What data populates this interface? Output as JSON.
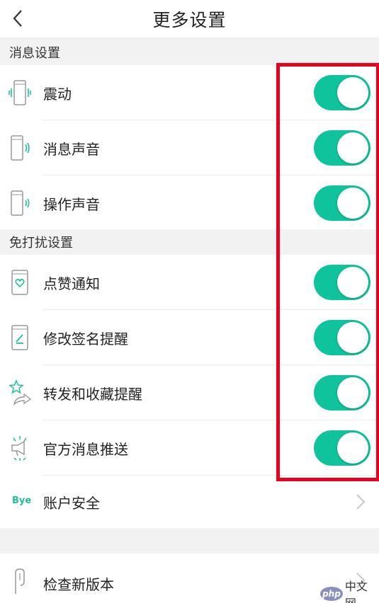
{
  "header": {
    "title": "更多设置"
  },
  "sections": {
    "message": "消息设置",
    "dnd": "免打扰设置"
  },
  "rows": {
    "vibrate": "震动",
    "message_sound": "消息声音",
    "action_sound": "操作声音",
    "like_notify": "点赞通知",
    "signature_remind": "修改签名提醒",
    "forward_fav_remind": "转发和收藏提醒",
    "official_push": "官方消息推送",
    "account_security": "账户安全",
    "check_update": "检查新版本"
  },
  "icons": {
    "bye_text": "Bye"
  },
  "toggles_on": [
    true,
    true,
    true,
    true,
    true,
    true,
    true
  ],
  "colors": {
    "accent": "#0fc49c",
    "highlight_border": "#e8001c",
    "icon_teal": "#1fbf9a"
  },
  "watermark": {
    "php": "php",
    "cn": "中文网"
  }
}
